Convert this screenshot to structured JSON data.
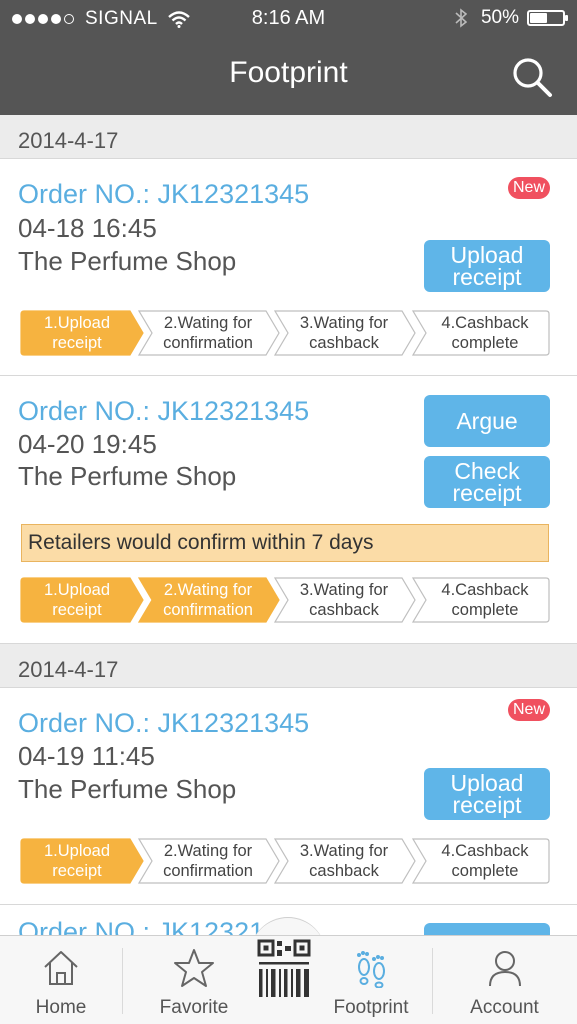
{
  "status_bar": {
    "carrier": "SIGNAL",
    "time": "8:16 AM",
    "battery": "50%",
    "battery_level": 0.5
  },
  "nav": {
    "title": "Footprint",
    "search_icon": "search-icon"
  },
  "groups": [
    {
      "date": "2014-4-17",
      "orders": [
        {
          "order_no": "Order NO.: JK12321345",
          "time": "04-18 16:45",
          "shop": "The Perfume Shop",
          "badge": "New",
          "buttons": [
            "Upload\nreceipt"
          ],
          "notice": "",
          "steps_done": 1
        },
        {
          "order_no": "Order NO.: JK12321345",
          "time": "04-20 19:45",
          "shop": "The Perfume Shop",
          "badge": "",
          "buttons": [
            "Argue",
            "Check\nreceipt"
          ],
          "notice": "Retailers would confirm within 7 days",
          "steps_done": 2
        }
      ]
    },
    {
      "date": "2014-4-17",
      "orders": [
        {
          "order_no": "Order NO.: JK12321345",
          "time": "04-19 11:45",
          "shop": "The Perfume Shop",
          "badge": "New",
          "buttons": [
            "Upload\nreceipt"
          ],
          "notice": "",
          "steps_done": 1
        },
        {
          "order_no": "Order NO.: JK12321...",
          "partial": true
        }
      ]
    }
  ],
  "steps": [
    "1.Upload receipt",
    "2.Wating for confirmation",
    "3.Wating for cashback",
    "4.Cashback complete"
  ],
  "tabs": [
    {
      "label": "Home",
      "icon": "home-icon",
      "active": false
    },
    {
      "label": "Favorite",
      "icon": "star-icon",
      "active": false
    },
    {
      "label": "",
      "icon": "qr-scan-icon",
      "active": false
    },
    {
      "label": "Footprint",
      "icon": "footprint-icon",
      "active": true
    },
    {
      "label": "Account",
      "icon": "account-icon",
      "active": false
    }
  ],
  "colors": {
    "nav_bg": "#555555",
    "accent_blue": "#5aaee0",
    "button_blue": "#5fb5e8",
    "step_done": "#f6b340",
    "badge_red": "#f0505f",
    "notice_bg": "#fbdca7"
  }
}
